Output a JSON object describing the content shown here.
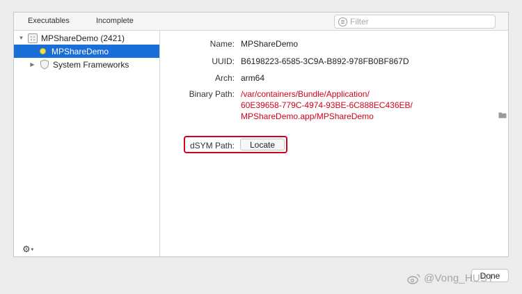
{
  "tabs": [
    "Executables",
    "Incomplete"
  ],
  "filter": {
    "placeholder": "Filter"
  },
  "sidebar": {
    "items": [
      {
        "label": "MPShareDemo (2421)",
        "icon": "app-grid-icon"
      },
      {
        "label": "MPShareDemo",
        "icon": "yellow-dot-icon",
        "selected": true
      },
      {
        "label": "System Frameworks",
        "icon": "shield-icon"
      }
    ],
    "action_icon": "⚙"
  },
  "detail": {
    "name_label": "Name:",
    "name_value": "MPShareDemo",
    "uuid_label": "UUID:",
    "uuid_value": "B6198223-6585-3C9A-B892-978FB0BF867D",
    "arch_label": "Arch:",
    "arch_value": "arm64",
    "binary_label": "Binary Path:",
    "binary_lines": [
      "/var/containers/Bundle/Application/",
      "60E39658-779C-4974-93BE-6C888EC436EB/",
      "MPShareDemo.app/MPShareDemo"
    ],
    "dsym_label": "dSYM Path:",
    "locate_label": "Locate"
  },
  "done_label": "Done",
  "watermark": "@Vong_HUST",
  "colors": {
    "selection": "#1a6ed8",
    "path_red": "#d0021b",
    "highlight_frame": "#d0021b"
  }
}
